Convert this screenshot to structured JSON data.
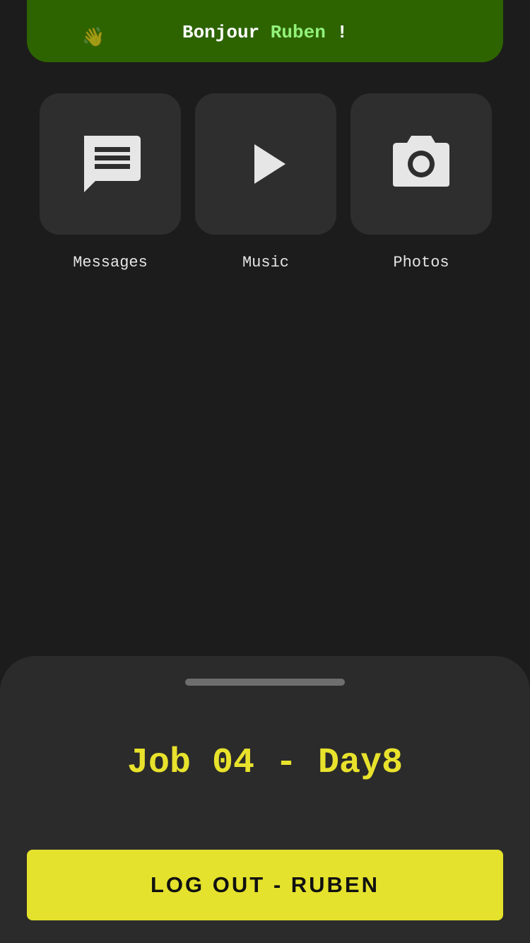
{
  "header": {
    "wave_icon": "waving-hand-icon",
    "wave_glyph": "👋",
    "greeting_prefix": "Bonjour ",
    "user_name": "Ruben",
    "greeting_suffix": " !"
  },
  "apps": [
    {
      "label": "Messages",
      "icon": "chat-message-icon"
    },
    {
      "label": "Music",
      "icon": "play-icon"
    },
    {
      "label": "Photos",
      "icon": "camera-icon"
    }
  ],
  "sheet": {
    "title": "Job 04 - Day8",
    "logout_label": "LOG OUT - RUBEN"
  },
  "colors": {
    "background": "#1c1c1c",
    "banner": "#2d6400",
    "name_accent": "#93f27a",
    "tile": "#2e2e2e",
    "sheet": "#2b2b2b",
    "title_accent": "#e8e22c",
    "button": "#e4e22c"
  }
}
